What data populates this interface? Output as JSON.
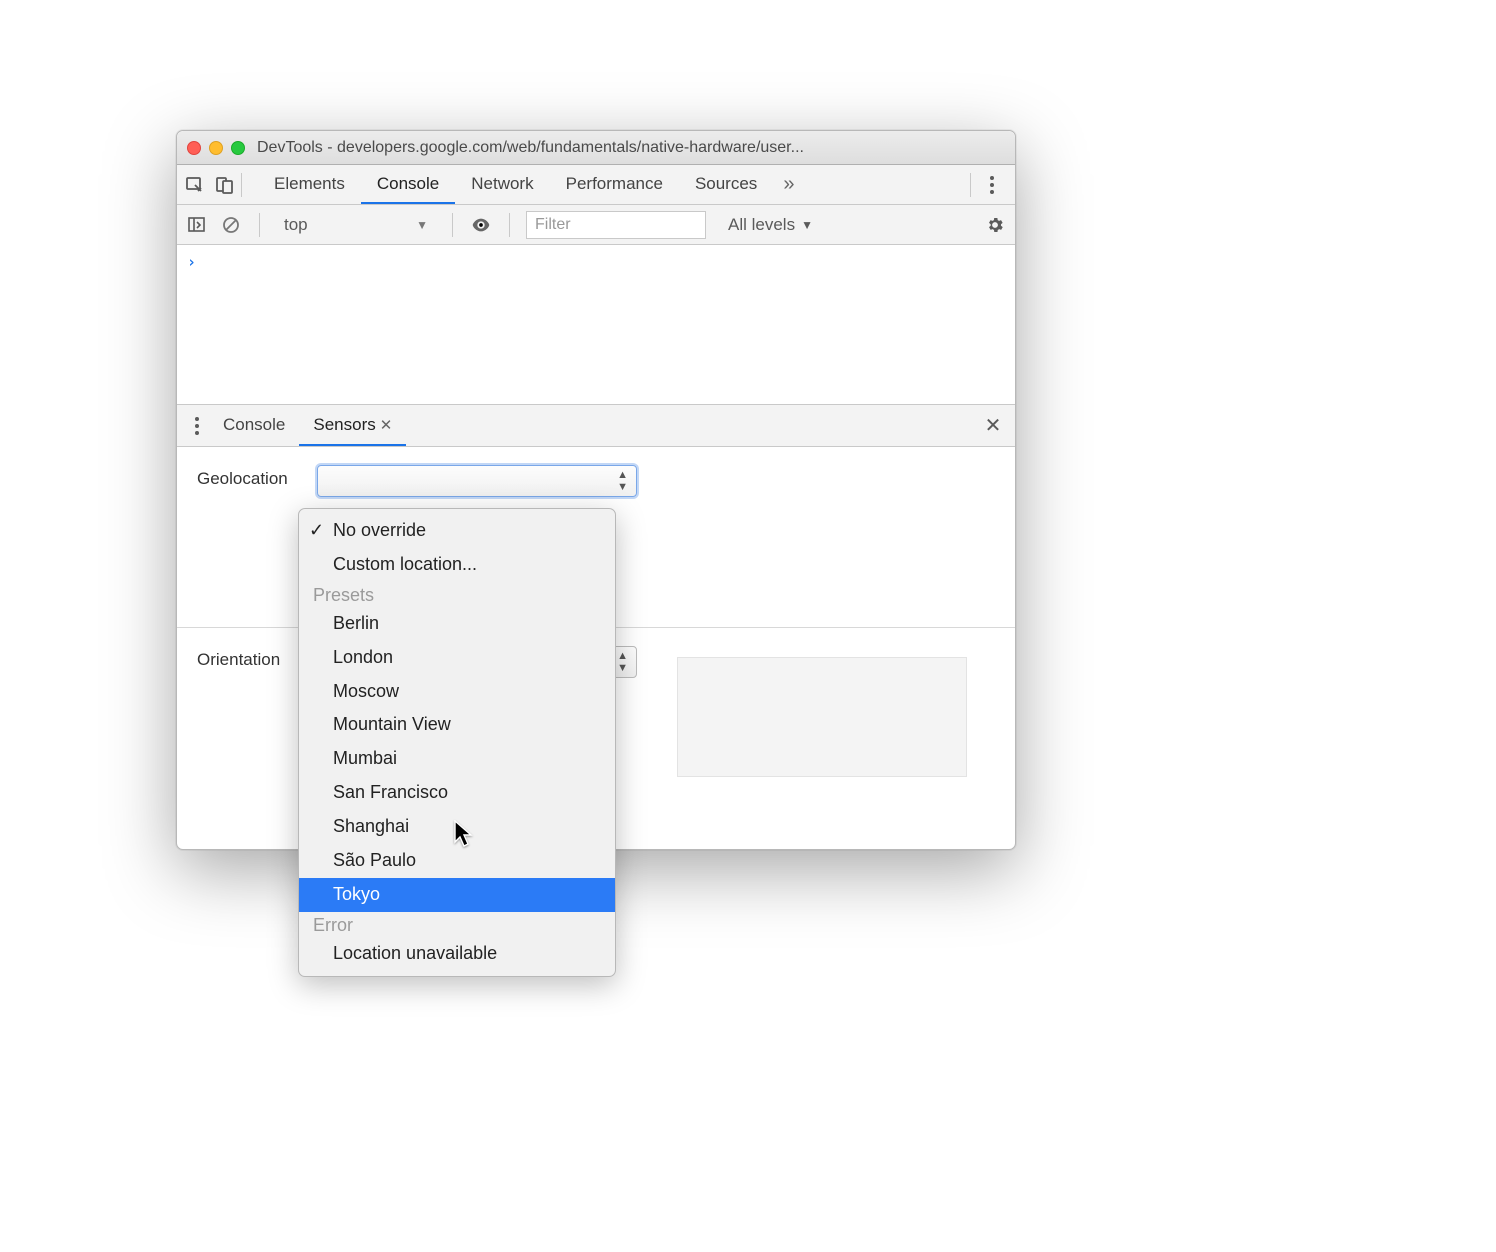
{
  "window": {
    "title": "DevTools - developers.google.com/web/fundamentals/native-hardware/user..."
  },
  "tabs": {
    "elements": "Elements",
    "console": "Console",
    "network": "Network",
    "performance": "Performance",
    "sources": "Sources",
    "overflow": "»"
  },
  "console_toolbar": {
    "context": "top",
    "filter_placeholder": "Filter",
    "levels": "All levels",
    "caret": "▼"
  },
  "drawer": {
    "console_tab": "Console",
    "sensors_tab": "Sensors"
  },
  "sensors": {
    "geolocation_label": "Geolocation",
    "orientation_label": "Orientation"
  },
  "dropdown": {
    "no_override": "No override",
    "custom": "Custom location...",
    "presets_label": "Presets",
    "presets": [
      "Berlin",
      "London",
      "Moscow",
      "Mountain View",
      "Mumbai",
      "San Francisco",
      "Shanghai",
      "São Paulo",
      "Tokyo"
    ],
    "error_label": "Error",
    "error_item": "Location unavailable",
    "highlighted": "Tokyo",
    "checked": "No override"
  }
}
